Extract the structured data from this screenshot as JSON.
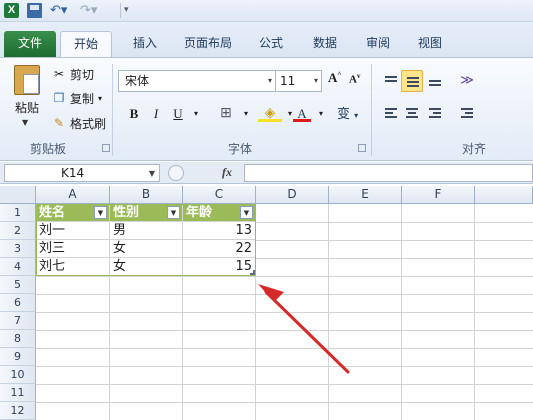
{
  "quick_access": {
    "logo": "X"
  },
  "tabs": [
    {
      "label": "文件"
    },
    {
      "label": "开始"
    },
    {
      "label": "插入"
    },
    {
      "label": "页面布局"
    },
    {
      "label": "公式"
    },
    {
      "label": "数据"
    },
    {
      "label": "审阅"
    },
    {
      "label": "视图"
    }
  ],
  "clipboard": {
    "paste": "粘贴",
    "cut": "剪切",
    "copy": "复制",
    "format_painter": "格式刷",
    "group_label": "剪贴板"
  },
  "font": {
    "name": "宋体",
    "size": "11",
    "bold": "B",
    "italic": "I",
    "underline": "U",
    "group_label": "字体",
    "grow": "A",
    "shrink": "A",
    "font_color": "A",
    "phonetic": "变"
  },
  "alignment": {
    "group_label": "对齐"
  },
  "formula_bar": {
    "name_box": "K14",
    "fx": "fx"
  },
  "columns": [
    "A",
    "B",
    "C",
    "D",
    "E",
    "F"
  ],
  "rows": [
    "1",
    "2",
    "3",
    "4",
    "5",
    "6",
    "7",
    "8",
    "9",
    "10",
    "11",
    "12"
  ],
  "table": {
    "headers": [
      "姓名",
      "性别",
      "年龄"
    ],
    "rows": [
      [
        "刘一",
        "男",
        "13"
      ],
      [
        "刘三",
        "女",
        "22"
      ],
      [
        "刘七",
        "女",
        "15"
      ]
    ]
  },
  "colors": {
    "table_header": "#9bbb59",
    "file_tab": "#2a7d3e",
    "arrow": "#d42a2a"
  }
}
